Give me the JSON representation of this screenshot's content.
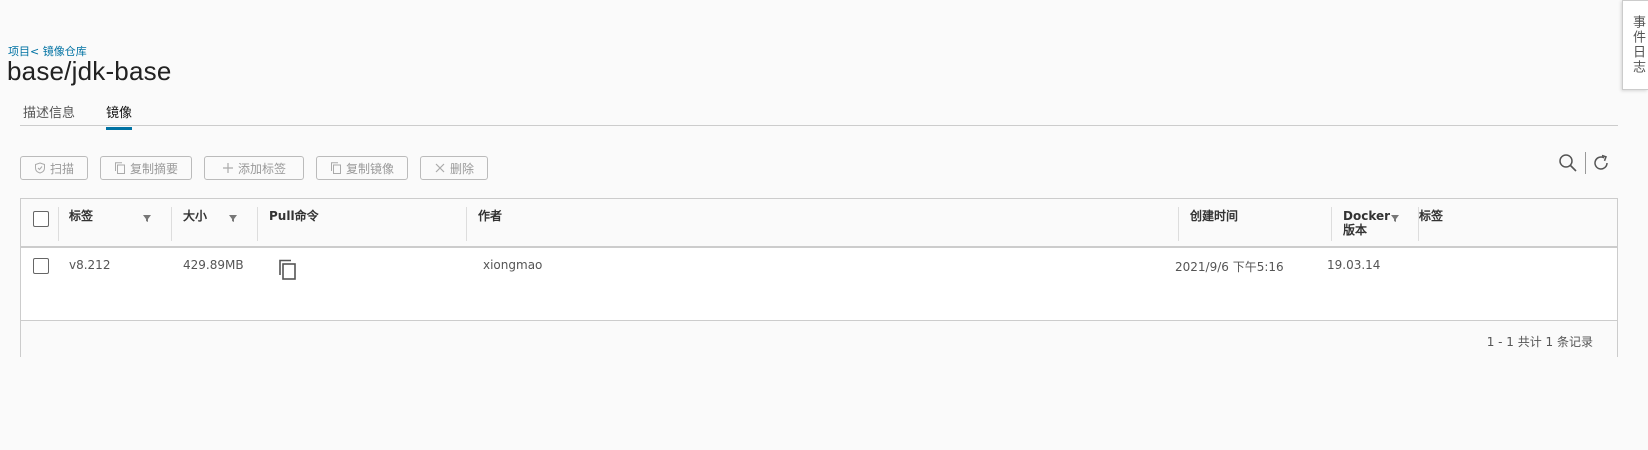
{
  "breadcrumb": {
    "project": "项目",
    "sep": "< ",
    "registry": "镜像仓库"
  },
  "page_title": "base/jdk-base",
  "tabs": [
    {
      "label": "描述信息"
    },
    {
      "label": "镜像"
    }
  ],
  "toolbar": {
    "scan": "扫描",
    "copy_digest": "复制摘要",
    "add_tag": "添加标签",
    "copy_image": "复制镜像",
    "delete": "删除"
  },
  "table": {
    "columns": {
      "tag": "标签",
      "size": "大小",
      "pull": "Pull命令",
      "author": "作者",
      "created": "创建时间",
      "docker_line1": "Docker",
      "docker_line2": "版本",
      "labels": "标签"
    },
    "rows": [
      {
        "tag": "v8.212",
        "size": "429.89MB",
        "author": "xiongmao",
        "created": "2021/9/6 下午5:16",
        "docker": "19.03.14"
      }
    ],
    "footer": "1 - 1 共计 1 条记录"
  },
  "side_panel": {
    "label": "事件日志"
  },
  "colors": {
    "link": "#0072a3",
    "active_tab": "#0072a3"
  }
}
